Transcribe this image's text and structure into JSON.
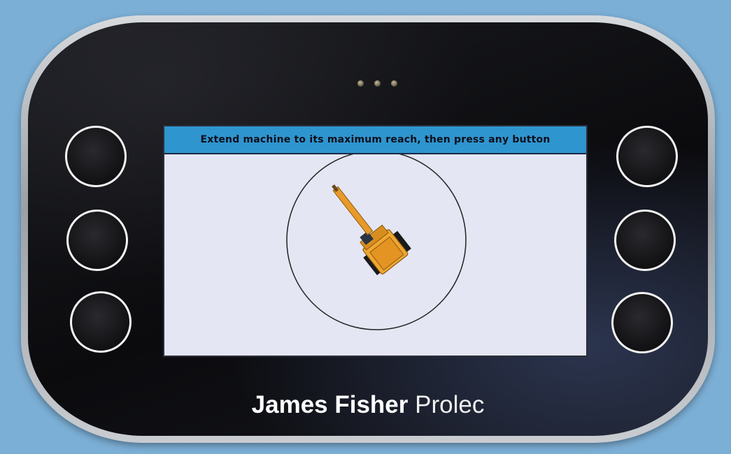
{
  "device": {
    "brand": {
      "name_bold": "James Fisher",
      "name_light": "Prolec"
    },
    "indicator_leds": [
      "led-1",
      "led-2",
      "led-3"
    ],
    "left_buttons": [
      "left-button-top",
      "left-button-middle",
      "left-button-bottom"
    ],
    "right_buttons": [
      "right-button-top",
      "right-button-middle",
      "right-button-bottom"
    ]
  },
  "screen": {
    "instruction": "Extend machine to its maximum reach, then press any button",
    "colors": {
      "banner": "#2f95cf",
      "background": "#e4e6f3",
      "machine_body": "#f0a630"
    },
    "graphic": {
      "icon": "excavator-icon",
      "boundary": "reach-circle"
    }
  }
}
